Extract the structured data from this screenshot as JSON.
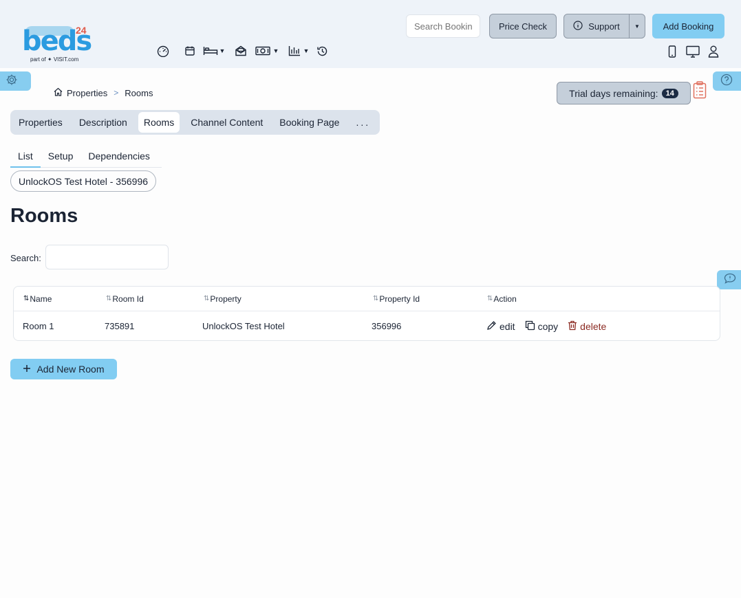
{
  "logo": {
    "brand": "beds",
    "number": "24",
    "tagline": "part of ✦ VISIT.com"
  },
  "header": {
    "search_placeholder": "Search Bookings",
    "price_check_label": "Price Check",
    "support_label": "Support",
    "add_booking_label": "Add Booking"
  },
  "breadcrumb": {
    "root": "Properties",
    "separator": ">",
    "current": "Rooms"
  },
  "trial": {
    "label": "Trial days remaining:",
    "days": "14"
  },
  "tabs": [
    {
      "label": "Properties"
    },
    {
      "label": "Description"
    },
    {
      "label": "Rooms",
      "active": true
    },
    {
      "label": "Channel Content"
    },
    {
      "label": "Booking Page"
    },
    {
      "label": "..."
    }
  ],
  "subtabs": [
    {
      "label": "List",
      "active": true
    },
    {
      "label": "Setup"
    },
    {
      "label": "Dependencies"
    }
  ],
  "property_selector": "UnlockOS Test Hotel - 356996",
  "page_title": "Rooms",
  "search": {
    "label": "Search:",
    "value": ""
  },
  "table": {
    "columns": [
      "Name",
      "Room Id",
      "Property",
      "Property Id",
      "Action"
    ],
    "rows": [
      {
        "name": "Room 1",
        "room_id": "735891",
        "property": "UnlockOS Test Hotel",
        "property_id": "356996"
      }
    ],
    "actions": {
      "edit": "edit",
      "copy": "copy",
      "delete": "delete"
    }
  },
  "add_room_label": "Add New Room",
  "colors": {
    "accent": "#82cdf2",
    "header_bg": "#eef3f9",
    "delete": "#8b2a22",
    "logo_blue": "#2b9be0",
    "logo_red": "#e05a4a"
  }
}
